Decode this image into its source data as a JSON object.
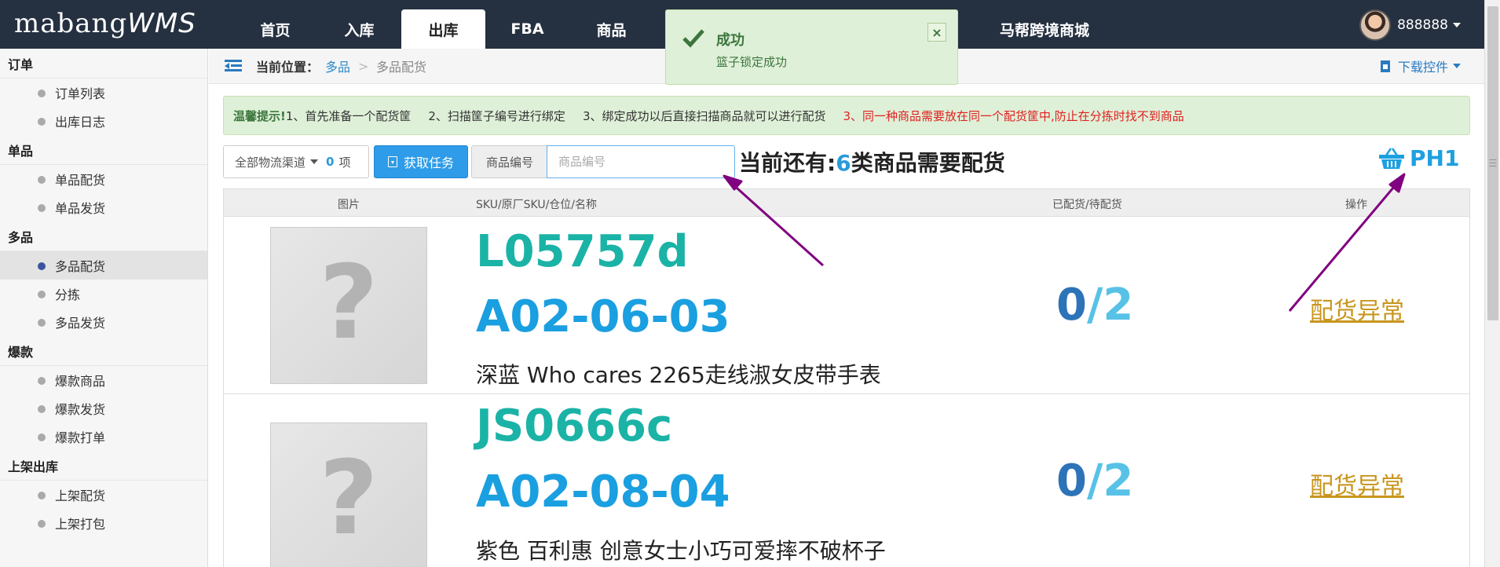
{
  "app": {
    "logo_main": "mabang",
    "logo_wms": "WMS",
    "nav": [
      "首页",
      "入库",
      "出库",
      "FBA",
      "商品"
    ],
    "nav_extra": "马帮跨境商城",
    "user": "888888"
  },
  "sidebar": {
    "sections": [
      {
        "title": "订单",
        "items": [
          "订单列表",
          "出库日志"
        ]
      },
      {
        "title": "单品",
        "items": [
          "单品配货",
          "单品发货"
        ]
      },
      {
        "title": "多品",
        "items": [
          "多品配货",
          "分拣",
          "多品发货"
        ]
      },
      {
        "title": "爆款",
        "items": [
          "爆款商品",
          "爆款发货",
          "爆款打单"
        ]
      },
      {
        "title": "上架出库",
        "items": [
          "上架配货",
          "上架打包"
        ]
      }
    ]
  },
  "breadcrumb": {
    "label": "当前位置：",
    "parent": "多品",
    "separator": ">",
    "current": "多品配货",
    "download": "下载控件"
  },
  "toast": {
    "title": "成功",
    "message": "篮子锁定成功",
    "close": "×"
  },
  "tip": {
    "label": "温馨提示!",
    "step1": "1、首先准备一个配货筐",
    "step2": "2、扫描筐子编号进行绑定",
    "step3": "3、绑定成功以后直接扫描商品就可以进行配货",
    "step4": "3、同一种商品需要放在同一个配货筐中,防止在分拣时找不到商品"
  },
  "toolbar": {
    "channel_label": "全部物流渠道",
    "channel_count": "0",
    "channel_unit": "项",
    "task_button": "获取任务",
    "sku_addon": "商品编号",
    "sku_placeholder": "商品编号",
    "remaining_prefix": "当前还有:",
    "remaining_count": "6",
    "remaining_suffix": "类商品需要配货",
    "basket_label": "PH1"
  },
  "table": {
    "headers": [
      "图片",
      "SKU/原厂SKU/仓位/名称",
      "已配货/待配货",
      "操作"
    ],
    "rows": [
      {
        "sku": "L05757d",
        "location": "A02-06-03",
        "name": "深蓝 Who cares 2265走线淑女皮带手表",
        "done": "0",
        "sep": "/",
        "total": "2",
        "action": "配货异常"
      },
      {
        "sku": "JS0666c",
        "location": "A02-08-04",
        "name": "紫色 百利惠 创意女士小巧可爱摔不破杯子",
        "done": "0",
        "sep": "/",
        "total": "2",
        "action": "配货异常"
      }
    ]
  },
  "colors": {
    "navbar": "#253040",
    "accent": "#2a9ad8",
    "sku_green": "#1ab3a6",
    "location_blue": "#1a9fe0",
    "exception_link": "#c8961e",
    "annotation_arrow": "#800080"
  },
  "icons": [
    "check-icon",
    "close-icon",
    "menu-icon",
    "download-icon",
    "basket-icon",
    "caret-down-icon",
    "placeholder-image-icon"
  ]
}
